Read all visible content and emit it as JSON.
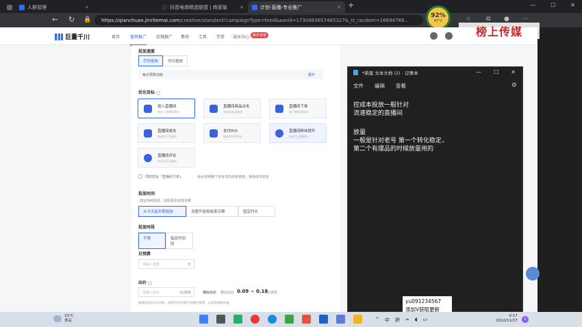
{
  "browser": {
    "tabs": [
      {
        "label": "人群管理",
        "active": false
      },
      {
        "label": "抖音电商精选联盟 | 商家版",
        "active": false
      },
      {
        "label": "计划-直播-专业推广",
        "active": true
      }
    ],
    "url_host": "https://qianchuan.jinritemai.com",
    "url_path": "/creative/standard?campaignType=feed&aavid=1730083657485327&_tt_random=16694789..."
  },
  "speed_badge": {
    "value": "92",
    "unit": "%",
    "sub": "47°C"
  },
  "watermark": "榜上传媒",
  "app": {
    "name": "巨量千川",
    "nav": [
      "首页",
      "营销推广",
      "店铺推广",
      "素材",
      "工具",
      "学堂",
      "成长中心"
    ],
    "nav_badge": "新手专享"
  },
  "form": {
    "s1_title": "投放速度",
    "s1_options": [
      "尽快投放",
      "均匀投放"
    ],
    "s1_hint": "每日预算消耗",
    "s1_right": "展开",
    "s2_title": "优化目标",
    "goals": [
      {
        "label": "进入直播间",
        "desc": "有进入直播间意向"
      },
      {
        "label": "直播间商品点击",
        "desc": "有点击商品意向"
      },
      {
        "label": "直播间下单",
        "desc": "有下单购买意向"
      },
      {
        "label": "直播间成交",
        "desc": "有成交行为意向"
      },
      {
        "label": "支付ROI",
        "desc": "按成交ROI优化"
      },
      {
        "label": "直播间粉丝提升",
        "desc": "有关注主播意向"
      },
      {
        "label": "直播间评论",
        "desc": "有评论互动意向"
      }
    ],
    "opt_check": "同时优化「直播间下单」",
    "opt_note": "适合有明确下单诉求的商家使用，保持成本稳定",
    "s3_title": "投放时间",
    "s3_hint": "建议持续投放，获取更多有效流量",
    "s3_options": [
      "从今天起长期投放",
      "设置开始和结束日期",
      "固定时长"
    ],
    "s4_title": "投放时段",
    "s4_options": [
      "不限",
      "指定时间段"
    ],
    "s5_title": "日预算",
    "s5_placeholder": "请输入金额",
    "s5_unit": "元",
    "s6_title": "出价",
    "s6_placeholder": "请输入出价",
    "s6_unit": "元/进房",
    "s6_ref_label": "相似出价",
    "s6_ref_sub": "建议出价",
    "s6_range": "0.09 ~ 0.18",
    "s6_range_unit": "元/进房",
    "footer_note": "按进房出价(oCPM)，扣费方式为按千次展示扣费，以实际消耗为准"
  },
  "notepad": {
    "title": "*新建 文本文档 (2) - 记事本",
    "menu": [
      "文件",
      "编辑",
      "查看"
    ],
    "lines": [
      "控成本投放一般针对",
      "流速稳定的直播间",
      "",
      "放量",
      "一般是针对老号  第一个转化稳定，",
      "第二个有爆品的时候放量用的"
    ]
  },
  "overlay_note": [
    "yu091234567",
    "添加V获取更新"
  ],
  "taskbar": {
    "weather_temp": "21°C",
    "weather_desc": "多云",
    "ime_lang": "中",
    "ime_mode": "拼",
    "time": "0:17",
    "date": "2022/11/27",
    "notif_count": "1"
  },
  "colors": {
    "accent": "#2f6bff",
    "badge": "#e84a4a",
    "watermark": "#c1282d"
  }
}
